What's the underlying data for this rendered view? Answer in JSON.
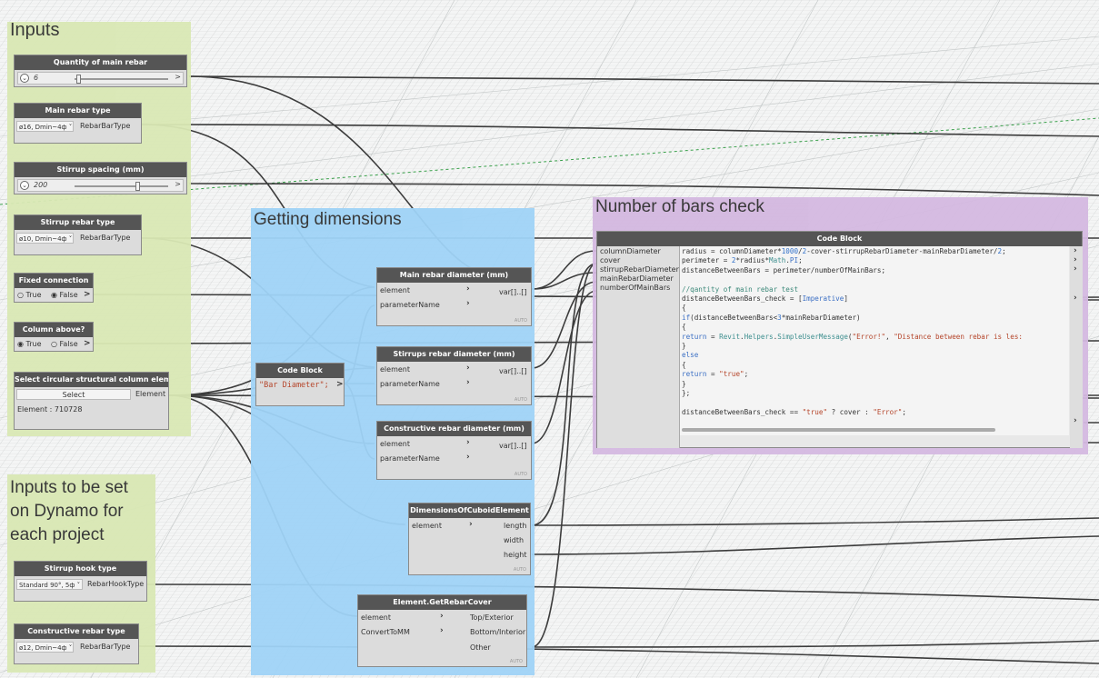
{
  "groups": {
    "inputs": "Inputs",
    "getting_dimensions": "Getting dimensions",
    "bars_check": "Number of bars check",
    "inputs_project": [
      "Inputs to be set",
      "on Dynamo for",
      "each project"
    ]
  },
  "colors": {
    "group_green": "#d9e8b4",
    "group_blue": "#9fd3f7",
    "group_purple": "#d4b8e0",
    "node_header": "#555555",
    "node_body": "#dcdcdc",
    "wire": "#3c3c3c"
  },
  "nodes": {
    "qty_main_rebar": {
      "title": "Quantity of main rebar",
      "value": "6",
      "end": ">",
      "position_fraction": 0.02
    },
    "main_rebar_type": {
      "title": "Main rebar type",
      "dropdown": "ø16, Dmin~4ф",
      "output": "RebarBarType"
    },
    "stirrup_spacing": {
      "title": "Stirrup spacing (mm)",
      "value": "200",
      "end": ">",
      "position_fraction": 0.65
    },
    "stirrup_rebar_type": {
      "title": "Stirrup rebar type",
      "dropdown": "ø10, Dmin~4ф",
      "output": "RebarBarType"
    },
    "fixed_connection": {
      "title": "Fixed connection",
      "opt_true": "True",
      "opt_false": "False",
      "selected": "False",
      "end": ">"
    },
    "column_above": {
      "title": "Column above?",
      "opt_true": "True",
      "opt_false": "False",
      "selected": "True",
      "end": ">"
    },
    "select_column": {
      "title": "Select circular structural column element",
      "button": "Select",
      "output": "Element",
      "status": "Element : 710728"
    },
    "stirrup_hook": {
      "title": "Stirrup hook type",
      "dropdown": "Standard 90°, 5ф",
      "output": "RebarHookType"
    },
    "constructive_rebar_type": {
      "title": "Constructive rebar type",
      "dropdown": "ø12, Dmin~4ф",
      "output": "RebarBarType"
    },
    "code_block_small": {
      "title": "Code Block",
      "code": "\"Bar Diameter\";",
      "out": ">"
    },
    "main_rebar_diam": {
      "title": "Main rebar diameter (mm)",
      "in1": "element",
      "in2": "parameterName",
      "output": "var[]..[]",
      "auto": "AUTO"
    },
    "stirrups_rebar_diam": {
      "title": "Stirrups rebar diameter (mm)",
      "in1": "element",
      "in2": "parameterName",
      "output": "var[]..[]",
      "auto": "AUTO"
    },
    "constructive_rebar_diam": {
      "title": "Constructive rebar diameter (mm)",
      "in1": "element",
      "in2": "parameterName",
      "output": "var[]..[]",
      "auto": "AUTO"
    },
    "dimensions_cuboid": {
      "title": "DimensionsOfCuboidElement",
      "in1": "element",
      "out1": "length",
      "out2": "width",
      "out3": "height",
      "auto": "AUTO"
    },
    "get_rebar_cover": {
      "title": "Element.GetRebarCover",
      "in1": "element",
      "in2": "ConvertToMM",
      "out1": "Top/Exterior",
      "out2": "Bottom/Interior",
      "out3": "Other",
      "auto": "AUTO"
    },
    "code_block_big": {
      "title": "Code Block",
      "inputs": [
        "columnDiameter",
        "cover",
        "stirrupRebarDiameter",
        "mainRebarDiameter",
        "numberOfMainBars"
      ],
      "lines": [
        "radius = columnDiameter*1000/2-cover-stirrupRebarDiameter-mainRebarDiameter/2;",
        "perimeter = 2*radius*Math.PI;",
        "distanceBetweenBars = perimeter/numberOfMainBars;",
        "",
        "//qantity of main rebar test",
        "distanceBetweenBars_check = [Imperative]",
        "{",
        "if(distanceBetweenBars<3*mainRebarDiameter)",
        "{",
        "return = Revit.Helpers.SimpleUserMessage(\"Error!\", \"Distance between rebar is les:",
        "}",
        "else",
        "{",
        "return = \"true\";",
        "}",
        "};",
        "",
        "distanceBetweenBars_check == \"true\" ? cover : \"Error\";"
      ]
    }
  }
}
